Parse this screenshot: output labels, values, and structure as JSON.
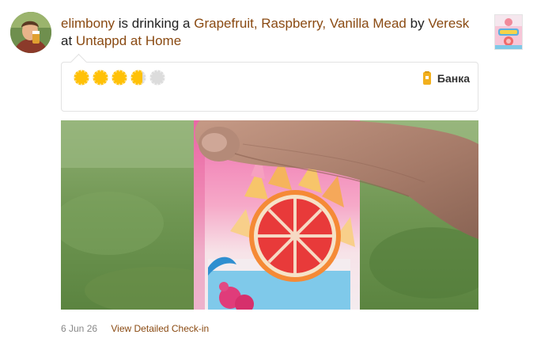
{
  "checkin": {
    "user": "elimbony",
    "action": "is drinking a",
    "beer": "Grapefruit, Raspberry, Vanilla Mead",
    "by_word": "by",
    "brewery": "Veresk",
    "at_word": "at",
    "venue": "Untappd at Home",
    "rating": 3.75,
    "rating_max": 5,
    "serving_style": "Банка",
    "date": "6 Jun 26",
    "detail_link": "View Detailed Check-in"
  },
  "icons": {
    "avatar": "user-avatar",
    "beer_label": "beer-label-thumbnail",
    "rating": "bottle-cap-icon",
    "serving": "can-icon"
  },
  "colors": {
    "link": "#8a4a12",
    "cap_filled": "#ffc107",
    "cap_empty": "#dcdcdc",
    "can": "#f2b01e",
    "date": "#888888"
  }
}
